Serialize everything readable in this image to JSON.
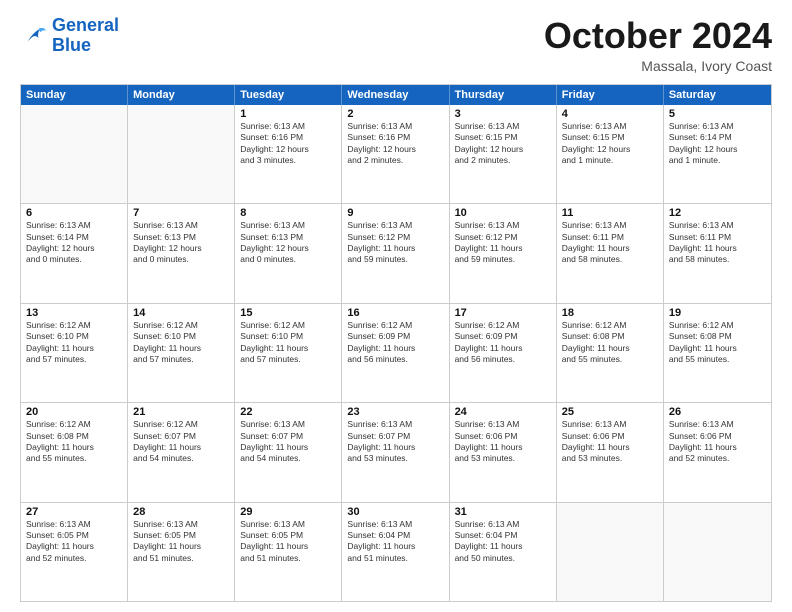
{
  "header": {
    "logo_general": "General",
    "logo_blue": "Blue",
    "month": "October 2024",
    "location": "Massala, Ivory Coast"
  },
  "days": [
    "Sunday",
    "Monday",
    "Tuesday",
    "Wednesday",
    "Thursday",
    "Friday",
    "Saturday"
  ],
  "rows": [
    [
      {
        "day": "",
        "empty": true
      },
      {
        "day": "",
        "empty": true
      },
      {
        "day": "1",
        "line1": "Sunrise: 6:13 AM",
        "line2": "Sunset: 6:16 PM",
        "line3": "Daylight: 12 hours",
        "line4": "and 3 minutes."
      },
      {
        "day": "2",
        "line1": "Sunrise: 6:13 AM",
        "line2": "Sunset: 6:16 PM",
        "line3": "Daylight: 12 hours",
        "line4": "and 2 minutes."
      },
      {
        "day": "3",
        "line1": "Sunrise: 6:13 AM",
        "line2": "Sunset: 6:15 PM",
        "line3": "Daylight: 12 hours",
        "line4": "and 2 minutes."
      },
      {
        "day": "4",
        "line1": "Sunrise: 6:13 AM",
        "line2": "Sunset: 6:15 PM",
        "line3": "Daylight: 12 hours",
        "line4": "and 1 minute."
      },
      {
        "day": "5",
        "line1": "Sunrise: 6:13 AM",
        "line2": "Sunset: 6:14 PM",
        "line3": "Daylight: 12 hours",
        "line4": "and 1 minute."
      }
    ],
    [
      {
        "day": "6",
        "line1": "Sunrise: 6:13 AM",
        "line2": "Sunset: 6:14 PM",
        "line3": "Daylight: 12 hours",
        "line4": "and 0 minutes."
      },
      {
        "day": "7",
        "line1": "Sunrise: 6:13 AM",
        "line2": "Sunset: 6:13 PM",
        "line3": "Daylight: 12 hours",
        "line4": "and 0 minutes."
      },
      {
        "day": "8",
        "line1": "Sunrise: 6:13 AM",
        "line2": "Sunset: 6:13 PM",
        "line3": "Daylight: 12 hours",
        "line4": "and 0 minutes."
      },
      {
        "day": "9",
        "line1": "Sunrise: 6:13 AM",
        "line2": "Sunset: 6:12 PM",
        "line3": "Daylight: 11 hours",
        "line4": "and 59 minutes."
      },
      {
        "day": "10",
        "line1": "Sunrise: 6:13 AM",
        "line2": "Sunset: 6:12 PM",
        "line3": "Daylight: 11 hours",
        "line4": "and 59 minutes."
      },
      {
        "day": "11",
        "line1": "Sunrise: 6:13 AM",
        "line2": "Sunset: 6:11 PM",
        "line3": "Daylight: 11 hours",
        "line4": "and 58 minutes."
      },
      {
        "day": "12",
        "line1": "Sunrise: 6:13 AM",
        "line2": "Sunset: 6:11 PM",
        "line3": "Daylight: 11 hours",
        "line4": "and 58 minutes."
      }
    ],
    [
      {
        "day": "13",
        "line1": "Sunrise: 6:12 AM",
        "line2": "Sunset: 6:10 PM",
        "line3": "Daylight: 11 hours",
        "line4": "and 57 minutes."
      },
      {
        "day": "14",
        "line1": "Sunrise: 6:12 AM",
        "line2": "Sunset: 6:10 PM",
        "line3": "Daylight: 11 hours",
        "line4": "and 57 minutes."
      },
      {
        "day": "15",
        "line1": "Sunrise: 6:12 AM",
        "line2": "Sunset: 6:10 PM",
        "line3": "Daylight: 11 hours",
        "line4": "and 57 minutes."
      },
      {
        "day": "16",
        "line1": "Sunrise: 6:12 AM",
        "line2": "Sunset: 6:09 PM",
        "line3": "Daylight: 11 hours",
        "line4": "and 56 minutes."
      },
      {
        "day": "17",
        "line1": "Sunrise: 6:12 AM",
        "line2": "Sunset: 6:09 PM",
        "line3": "Daylight: 11 hours",
        "line4": "and 56 minutes."
      },
      {
        "day": "18",
        "line1": "Sunrise: 6:12 AM",
        "line2": "Sunset: 6:08 PM",
        "line3": "Daylight: 11 hours",
        "line4": "and 55 minutes."
      },
      {
        "day": "19",
        "line1": "Sunrise: 6:12 AM",
        "line2": "Sunset: 6:08 PM",
        "line3": "Daylight: 11 hours",
        "line4": "and 55 minutes."
      }
    ],
    [
      {
        "day": "20",
        "line1": "Sunrise: 6:12 AM",
        "line2": "Sunset: 6:08 PM",
        "line3": "Daylight: 11 hours",
        "line4": "and 55 minutes."
      },
      {
        "day": "21",
        "line1": "Sunrise: 6:12 AM",
        "line2": "Sunset: 6:07 PM",
        "line3": "Daylight: 11 hours",
        "line4": "and 54 minutes."
      },
      {
        "day": "22",
        "line1": "Sunrise: 6:13 AM",
        "line2": "Sunset: 6:07 PM",
        "line3": "Daylight: 11 hours",
        "line4": "and 54 minutes."
      },
      {
        "day": "23",
        "line1": "Sunrise: 6:13 AM",
        "line2": "Sunset: 6:07 PM",
        "line3": "Daylight: 11 hours",
        "line4": "and 53 minutes."
      },
      {
        "day": "24",
        "line1": "Sunrise: 6:13 AM",
        "line2": "Sunset: 6:06 PM",
        "line3": "Daylight: 11 hours",
        "line4": "and 53 minutes."
      },
      {
        "day": "25",
        "line1": "Sunrise: 6:13 AM",
        "line2": "Sunset: 6:06 PM",
        "line3": "Daylight: 11 hours",
        "line4": "and 53 minutes."
      },
      {
        "day": "26",
        "line1": "Sunrise: 6:13 AM",
        "line2": "Sunset: 6:06 PM",
        "line3": "Daylight: 11 hours",
        "line4": "and 52 minutes."
      }
    ],
    [
      {
        "day": "27",
        "line1": "Sunrise: 6:13 AM",
        "line2": "Sunset: 6:05 PM",
        "line3": "Daylight: 11 hours",
        "line4": "and 52 minutes."
      },
      {
        "day": "28",
        "line1": "Sunrise: 6:13 AM",
        "line2": "Sunset: 6:05 PM",
        "line3": "Daylight: 11 hours",
        "line4": "and 51 minutes."
      },
      {
        "day": "29",
        "line1": "Sunrise: 6:13 AM",
        "line2": "Sunset: 6:05 PM",
        "line3": "Daylight: 11 hours",
        "line4": "and 51 minutes."
      },
      {
        "day": "30",
        "line1": "Sunrise: 6:13 AM",
        "line2": "Sunset: 6:04 PM",
        "line3": "Daylight: 11 hours",
        "line4": "and 51 minutes."
      },
      {
        "day": "31",
        "line1": "Sunrise: 6:13 AM",
        "line2": "Sunset: 6:04 PM",
        "line3": "Daylight: 11 hours",
        "line4": "and 50 minutes."
      },
      {
        "day": "",
        "empty": true
      },
      {
        "day": "",
        "empty": true
      }
    ]
  ]
}
